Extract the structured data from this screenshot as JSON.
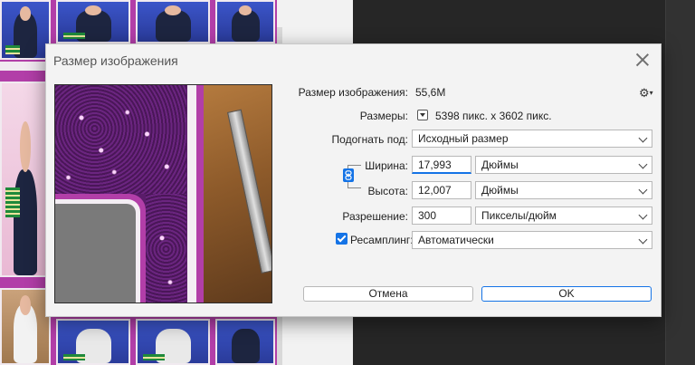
{
  "dialog": {
    "title": "Размер изображения",
    "image_size_label": "Размер изображения:",
    "image_size_value": "55,6M",
    "dimensions_label": "Размеры:",
    "dimensions_value": "5398 пикс. x 3602 пикс.",
    "fit_to_label": "Подогнать под:",
    "fit_to_value": "Исходный размер",
    "width_label": "Ширина:",
    "width_value": "17,993",
    "width_unit": "Дюймы",
    "height_label": "Высота:",
    "height_value": "12,007",
    "height_unit": "Дюймы",
    "resolution_label": "Разрешение:",
    "resolution_value": "300",
    "resolution_unit": "Пикселы/дюйм",
    "resample_label": "Ресамплинг:",
    "resample_checked": true,
    "resample_value": "Автоматически",
    "cancel_label": "Отмена",
    "ok_label": "OK"
  },
  "icons": {
    "close": "close-icon",
    "settings": "gear-icon",
    "constrain": "link-icon",
    "dimensions_menu": "chevron-down-icon"
  },
  "colors": {
    "accent": "#1473e6",
    "dialog_bg": "#f3f3f3",
    "canvas_magenta": "#b23ea8"
  }
}
